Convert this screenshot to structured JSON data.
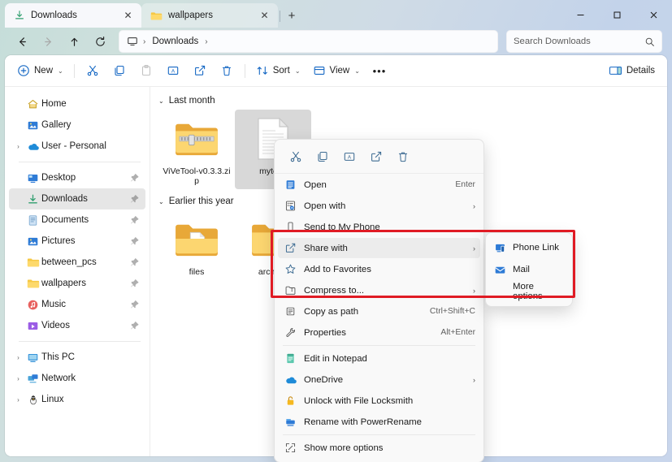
{
  "window": {
    "tabs": [
      {
        "label": "Downloads",
        "icon": "downloads-icon",
        "active": true,
        "close": "✕"
      },
      {
        "label": "wallpapers",
        "icon": "folder-icon",
        "active": false,
        "close": "✕"
      }
    ],
    "new_tab_label": "+",
    "controls": {
      "minimize": "—",
      "maximize": "❑",
      "close": "✕"
    }
  },
  "address": {
    "back": "←",
    "forward": "→",
    "up": "↑",
    "refresh": "⟳",
    "breadcrumb": {
      "root_icon": "this-pc-icon",
      "sep": "›",
      "path": "Downloads",
      "trailing_sep": "›"
    }
  },
  "search": {
    "placeholder": "Search Downloads",
    "icon": "search-icon"
  },
  "toolbar": {
    "new_label": "New",
    "chevron": "⌄",
    "cut_label": "Cut",
    "copy_label": "Copy",
    "paste_label": "Paste",
    "rename_label": "Rename",
    "share_label": "Share",
    "delete_label": "Delete",
    "sort_label": "Sort",
    "view_label": "View",
    "more_label": "•••",
    "details_label": "Details"
  },
  "sidebar": {
    "groups": [
      {
        "items": [
          {
            "label": "Home",
            "icon": "home-icon",
            "expander": false,
            "pinned": false,
            "selected": false
          },
          {
            "label": "Gallery",
            "icon": "gallery-icon",
            "expander": false,
            "pinned": false,
            "selected": false
          },
          {
            "label": "User - Personal",
            "icon": "onedrive-icon",
            "expander": true,
            "pinned": false,
            "selected": false
          }
        ]
      },
      {
        "items": [
          {
            "label": "Desktop",
            "icon": "desktop-icon",
            "expander": false,
            "pinned": true,
            "selected": false
          },
          {
            "label": "Downloads",
            "icon": "downloads-icon",
            "expander": false,
            "pinned": true,
            "selected": true
          },
          {
            "label": "Documents",
            "icon": "documents-icon",
            "expander": false,
            "pinned": true,
            "selected": false
          },
          {
            "label": "Pictures",
            "icon": "pictures-icon",
            "expander": false,
            "pinned": true,
            "selected": false
          },
          {
            "label": "between_pcs",
            "icon": "folder-icon",
            "expander": false,
            "pinned": true,
            "selected": false
          },
          {
            "label": "wallpapers",
            "icon": "folder-icon",
            "expander": false,
            "pinned": true,
            "selected": false
          },
          {
            "label": "Music",
            "icon": "music-icon",
            "expander": false,
            "pinned": true,
            "selected": false
          },
          {
            "label": "Videos",
            "icon": "videos-icon",
            "expander": false,
            "pinned": true,
            "selected": false
          }
        ]
      },
      {
        "items": [
          {
            "label": "This PC",
            "icon": "this-pc-icon",
            "expander": true,
            "pinned": false,
            "selected": false
          },
          {
            "label": "Network",
            "icon": "network-icon",
            "expander": true,
            "pinned": false,
            "selected": false
          },
          {
            "label": "Linux",
            "icon": "linux-icon",
            "expander": true,
            "pinned": false,
            "selected": false
          }
        ]
      }
    ],
    "expander_glyph": "›",
    "pin_glyph": "pin-icon"
  },
  "content": {
    "groups": [
      {
        "title": "Last month",
        "chevron": "⌄",
        "items": [
          {
            "label": "ViVeTool-v0.3.3.zip",
            "icon": "zip-folder-icon",
            "selected": false
          },
          {
            "label": "mytext.",
            "icon": "text-file-icon",
            "selected": true
          }
        ]
      },
      {
        "title": "Earlier this year",
        "chevron": "⌄",
        "items": [
          {
            "label": "files",
            "icon": "folder-with-file-icon",
            "selected": false
          },
          {
            "label": "archival",
            "icon": "folder-icon",
            "selected": false
          }
        ]
      }
    ]
  },
  "context_menu": {
    "quick_actions": [
      {
        "name": "cut-icon",
        "label": "Cut"
      },
      {
        "name": "copy-icon",
        "label": "Copy"
      },
      {
        "name": "rename-icon",
        "label": "Rename"
      },
      {
        "name": "share-icon",
        "label": "Share"
      },
      {
        "name": "delete-icon",
        "label": "Delete"
      }
    ],
    "items": [
      {
        "label": "Open",
        "icon": "open-icon",
        "accel": "Enter",
        "submenu": false,
        "hover": false,
        "sep_after": false
      },
      {
        "label": "Open with",
        "icon": "open-with-icon",
        "accel": "",
        "submenu": true,
        "hover": false,
        "sep_after": false
      },
      {
        "label": "Send to My Phone",
        "icon": "phone-icon",
        "accel": "",
        "submenu": false,
        "hover": false,
        "sep_after": false
      },
      {
        "label": "Share with",
        "icon": "share-icon",
        "accel": "",
        "submenu": true,
        "hover": true,
        "sep_after": false
      },
      {
        "label": "Add to Favorites",
        "icon": "star-icon",
        "accel": "",
        "submenu": false,
        "hover": false,
        "sep_after": false
      },
      {
        "label": "Compress to...",
        "icon": "compress-icon",
        "accel": "",
        "submenu": true,
        "hover": false,
        "sep_after": false
      },
      {
        "label": "Copy as path",
        "icon": "copy-path-icon",
        "accel": "Ctrl+Shift+C",
        "submenu": false,
        "hover": false,
        "sep_after": false
      },
      {
        "label": "Properties",
        "icon": "properties-icon",
        "accel": "Alt+Enter",
        "submenu": false,
        "hover": false,
        "sep_after": true
      },
      {
        "label": "Edit in Notepad",
        "icon": "notepad-icon",
        "accel": "",
        "submenu": false,
        "hover": false,
        "sep_after": false
      },
      {
        "label": "OneDrive",
        "icon": "onedrive-icon",
        "accel": "",
        "submenu": true,
        "hover": false,
        "sep_after": false
      },
      {
        "label": "Unlock with File Locksmith",
        "icon": "lock-icon",
        "accel": "",
        "submenu": false,
        "hover": false,
        "sep_after": false
      },
      {
        "label": "Rename with PowerRename",
        "icon": "powerrename-icon",
        "accel": "",
        "submenu": false,
        "hover": false,
        "sep_after": true
      },
      {
        "label": "Show more options",
        "icon": "more-options-icon",
        "accel": "",
        "submenu": false,
        "hover": false,
        "sep_after": false
      }
    ],
    "submenu_arrow": "›"
  },
  "submenu": {
    "items": [
      {
        "label": "Phone Link",
        "icon": "phone-link-icon"
      },
      {
        "label": "Mail",
        "icon": "mail-icon"
      },
      {
        "label": "More options",
        "icon": ""
      }
    ]
  },
  "highlight": {
    "color": "#e01b24"
  }
}
